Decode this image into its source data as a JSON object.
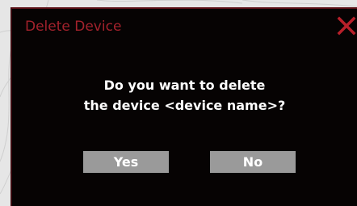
{
  "dialog": {
    "title": "Delete Device",
    "message_line1": "Do you want to delete",
    "message_line2": "the device <device name>?",
    "close_icon": "close-x-icon",
    "yes_label": "Yes",
    "no_label": "No"
  },
  "colors": {
    "dialog_background": "#060303",
    "title_color": "#a3222c",
    "close_color": "#b8202a",
    "button_background": "#9a9a9a",
    "button_text": "#ffffff",
    "message_text": "#ffffff",
    "page_background": "#e4e4e4"
  }
}
